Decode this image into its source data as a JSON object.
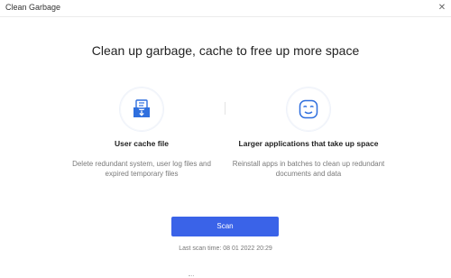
{
  "window": {
    "title": "Clean Garbage",
    "close_glyph": "✕"
  },
  "main": {
    "heading": "Clean up garbage, cache to free up more space",
    "features": [
      {
        "icon": "inbox-download-icon",
        "title": "User cache file",
        "description": "Delete redundant system, user log files and expired temporary files"
      },
      {
        "icon": "smiley-face-icon",
        "title": "Larger applications that take up space",
        "description": "Reinstall apps in batches to clean up redundant documents and data"
      }
    ],
    "scan_button_label": "Scan",
    "last_scan": "Last scan time: 08 01 2022  20:29"
  },
  "colors": {
    "accent": "#3a63e8",
    "icon_blue": "#2f6fde"
  }
}
